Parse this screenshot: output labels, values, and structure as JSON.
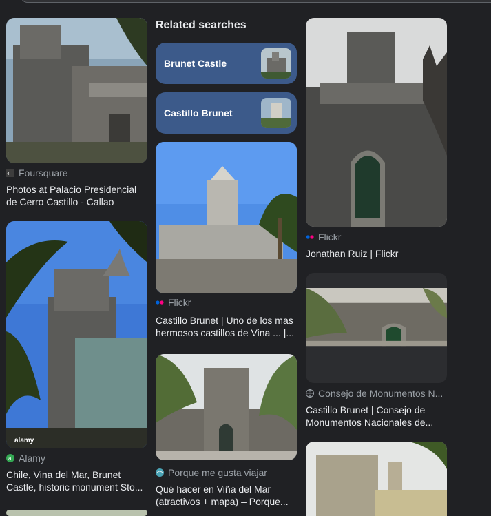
{
  "related": {
    "heading": "Related searches",
    "chips": [
      {
        "label": "Brunet Castle"
      },
      {
        "label": "Castillo Brunet"
      }
    ]
  },
  "results": [
    {
      "source": "Foursquare",
      "title": "Photos at Palacio Presidencial de Cerro Castillo - Callao",
      "favicon": "foursquare-icon"
    },
    {
      "source": "Alamy",
      "title": "Chile, Vina del Mar, Brunet Castle, historic monument Sto...",
      "favicon": "alamy-icon",
      "watermark": "alamy"
    },
    {
      "source": "Flickr",
      "title": "Castillo Brunet | Uno de los mas hermosos castillos de Vina ... |...",
      "favicon": "flickr-icon"
    },
    {
      "source": "Porque me gusta viajar",
      "title": "Qué hacer en Viña del Mar (atractivos + mapa) – Porque...",
      "favicon": "globe-icon"
    },
    {
      "source": "Flickr",
      "title": "Jonathan Ruiz | Flickr",
      "favicon": "flickr-icon"
    },
    {
      "source": "Consejo de Monumentos N...",
      "title": "Castillo Brunet | Consejo de Monumentos Nacionales de...",
      "favicon": "globe-icon"
    }
  ]
}
